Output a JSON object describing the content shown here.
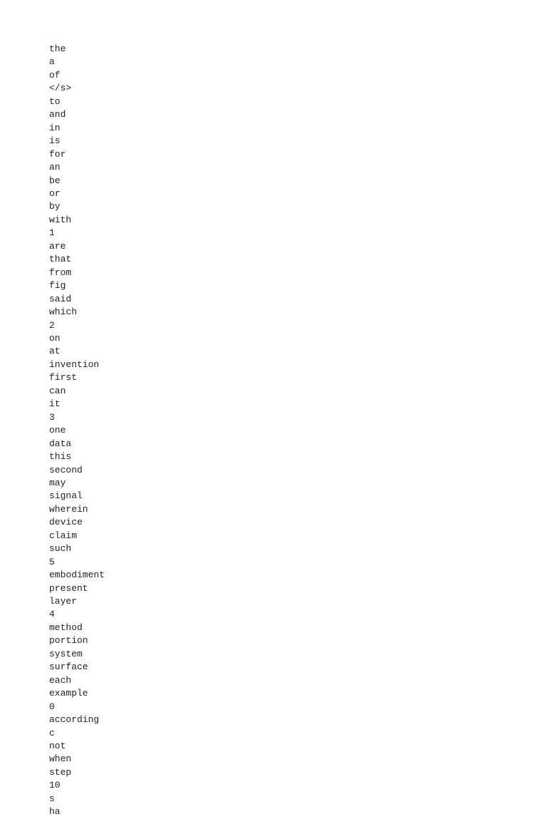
{
  "words": [
    "the",
    "a",
    "of",
    "</s>",
    "to",
    "and",
    "in",
    "is",
    "for",
    "an",
    "be",
    "or",
    "by",
    "with",
    "1",
    "are",
    "that",
    "from",
    "fig",
    "said",
    "which",
    "2",
    "on",
    "at",
    "invention",
    "first",
    "can",
    "it",
    "3",
    "one",
    "data",
    "this",
    "second",
    "may",
    "signal",
    "wherein",
    "device",
    "claim",
    "such",
    "5",
    "embodiment",
    "present",
    "layer",
    "4",
    "method",
    "portion",
    "system",
    "surface",
    "each",
    "example",
    "0",
    "according",
    "c",
    "not",
    "when",
    "step",
    "10",
    "s",
    "ha"
  ]
}
